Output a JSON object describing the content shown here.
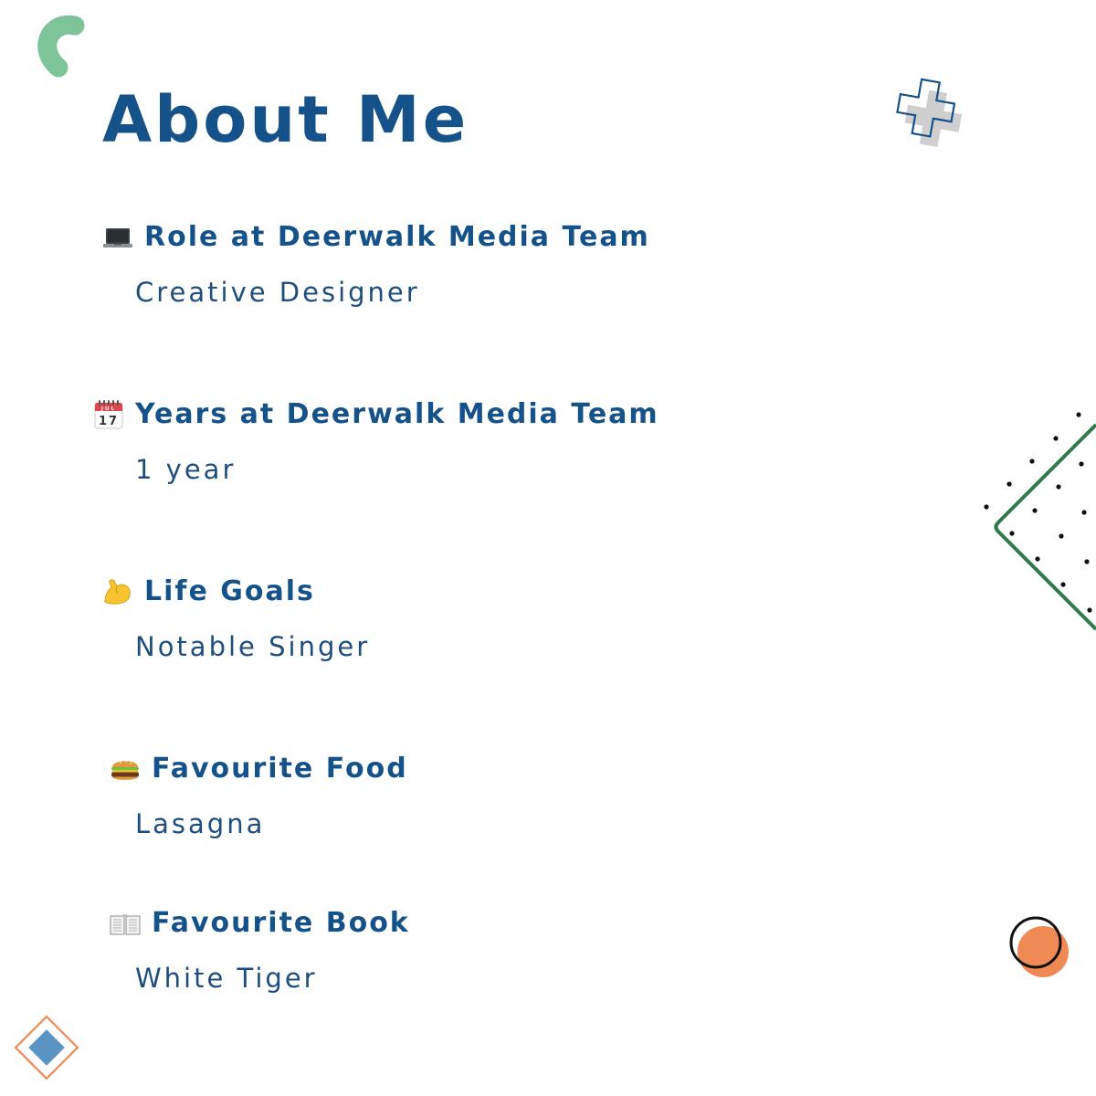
{
  "colors": {
    "heading": "#16528a",
    "value": "#1e4e7e",
    "green": "#7dc49b",
    "dark_green": "#2e7a4e",
    "orange": "#f08a55",
    "blue": "#5a94c4",
    "grey": "#cfcfcf"
  },
  "title": "About Me",
  "items": [
    {
      "icon": "laptop-icon",
      "heading": "Role at Deerwalk Media Team",
      "value": "Creative Designer"
    },
    {
      "icon": "calendar-icon",
      "heading": "Years at Deerwalk Media Team",
      "value": "1 year"
    },
    {
      "icon": "flexed-biceps-icon",
      "heading": "Life Goals",
      "value": "Notable Singer"
    },
    {
      "icon": "burger-icon",
      "heading": "Favourite Food",
      "value": "Lasagna"
    },
    {
      "icon": "open-book-icon",
      "heading": "Favourite Book",
      "value": "White Tiger"
    }
  ],
  "calendar_icon": {
    "month": "JUL",
    "day": "17"
  }
}
